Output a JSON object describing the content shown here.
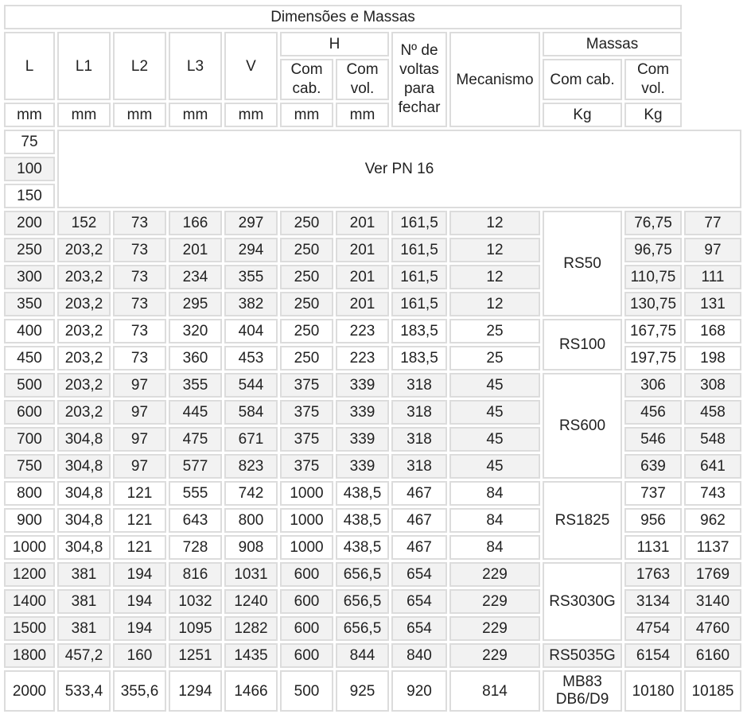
{
  "title": "Dimensões e Massas",
  "headers": {
    "L": "L",
    "L1": "L1",
    "L2": "L2",
    "L3": "L3",
    "V": "V",
    "H": "H",
    "H_cab": "Com cab.",
    "H_vol": "Com vol.",
    "voltas": "Nº de voltas para fechar",
    "mecanismo": "Mecanismo",
    "massas": "Massas",
    "m_cab": "Com cab.",
    "m_vol": "Com vol."
  },
  "units": {
    "L": "mm",
    "L1": "mm",
    "L2": "mm",
    "L3": "mm",
    "V": "mm",
    "H_cab": "mm",
    "H_vol": "mm",
    "m_cab": "Kg",
    "m_vol": "Kg"
  },
  "pn16": {
    "sizes": [
      "75",
      "100",
      "150"
    ],
    "note": "Ver PN 16"
  },
  "rows": [
    {
      "L": "200",
      "L1": "152",
      "L2": "73",
      "L3": "166",
      "V": "297",
      "hc": "250",
      "hv": "201",
      "nv": "161,5",
      "me": "12",
      "mc": "76,75",
      "mv": "77"
    },
    {
      "L": "250",
      "L1": "203,2",
      "L2": "73",
      "L3": "201",
      "V": "294",
      "hc": "250",
      "hv": "201",
      "nv": "161,5",
      "me": "12",
      "mc": "96,75",
      "mv": "97"
    },
    {
      "L": "300",
      "L1": "203,2",
      "L2": "73",
      "L3": "234",
      "V": "355",
      "hc": "250",
      "hv": "201",
      "nv": "161,5",
      "me": "12",
      "mc": "110,75",
      "mv": "111"
    },
    {
      "L": "350",
      "L1": "203,2",
      "L2": "73",
      "L3": "295",
      "V": "382",
      "hc": "250",
      "hv": "201",
      "nv": "161,5",
      "me": "12",
      "mc": "130,75",
      "mv": "131"
    },
    {
      "L": "400",
      "L1": "203,2",
      "L2": "73",
      "L3": "320",
      "V": "404",
      "hc": "250",
      "hv": "223",
      "nv": "183,5",
      "me": "25",
      "mc": "167,75",
      "mv": "168"
    },
    {
      "L": "450",
      "L1": "203,2",
      "L2": "73",
      "L3": "360",
      "V": "453",
      "hc": "250",
      "hv": "223",
      "nv": "183,5",
      "me": "25",
      "mc": "197,75",
      "mv": "198"
    },
    {
      "L": "500",
      "L1": "203,2",
      "L2": "97",
      "L3": "355",
      "V": "544",
      "hc": "375",
      "hv": "339",
      "nv": "318",
      "me": "45",
      "mc": "306",
      "mv": "308"
    },
    {
      "L": "600",
      "L1": "203,2",
      "L2": "97",
      "L3": "445",
      "V": "584",
      "hc": "375",
      "hv": "339",
      "nv": "318",
      "me": "45",
      "mc": "456",
      "mv": "458"
    },
    {
      "L": "700",
      "L1": "304,8",
      "L2": "97",
      "L3": "475",
      "V": "671",
      "hc": "375",
      "hv": "339",
      "nv": "318",
      "me": "45",
      "mc": "546",
      "mv": "548"
    },
    {
      "L": "750",
      "L1": "304,8",
      "L2": "97",
      "L3": "577",
      "V": "823",
      "hc": "375",
      "hv": "339",
      "nv": "318",
      "me": "45",
      "mc": "639",
      "mv": "641"
    },
    {
      "L": "800",
      "L1": "304,8",
      "L2": "121",
      "L3": "555",
      "V": "742",
      "hc": "1000",
      "hv": "438,5",
      "nv": "467",
      "me": "84",
      "mc": "737",
      "mv": "743"
    },
    {
      "L": "900",
      "L1": "304,8",
      "L2": "121",
      "L3": "643",
      "V": "800",
      "hc": "1000",
      "hv": "438,5",
      "nv": "467",
      "me": "84",
      "mc": "956",
      "mv": "962"
    },
    {
      "L": "1000",
      "L1": "304,8",
      "L2": "121",
      "L3": "728",
      "V": "908",
      "hc": "1000",
      "hv": "438,5",
      "nv": "467",
      "me": "84",
      "mc": "1131",
      "mv": "1137"
    },
    {
      "L": "1200",
      "L1": "381",
      "L2": "194",
      "L3": "816",
      "V": "1031",
      "hc": "600",
      "hv": "656,5",
      "nv": "654",
      "me": "229",
      "mc": "1763",
      "mv": "1769"
    },
    {
      "L": "1400",
      "L1": "381",
      "L2": "194",
      "L3": "1032",
      "V": "1240",
      "hc": "600",
      "hv": "656,5",
      "nv": "654",
      "me": "229",
      "mc": "3134",
      "mv": "3140"
    },
    {
      "L": "1500",
      "L1": "381",
      "L2": "194",
      "L3": "1095",
      "V": "1282",
      "hc": "600",
      "hv": "656,5",
      "nv": "654",
      "me": "229",
      "mc": "4754",
      "mv": "4760"
    },
    {
      "L": "1800",
      "L1": "457,2",
      "L2": "160",
      "L3": "1251",
      "V": "1435",
      "hc": "600",
      "hv": "844",
      "nv": "840",
      "me": "229",
      "mc": "6154",
      "mv": "6160"
    },
    {
      "L": "2000",
      "L1": "533,4",
      "L2": "355,6",
      "L3": "1294",
      "V": "1466",
      "hc": "500",
      "hv": "925",
      "nv": "920",
      "me": "814",
      "mc": "10180",
      "mv": "10185"
    }
  ],
  "mechanism_groups": [
    {
      "label": "RS50",
      "start": 0,
      "span": 4
    },
    {
      "label": "RS100",
      "start": 4,
      "span": 2
    },
    {
      "label": "RS600",
      "start": 6,
      "span": 4
    },
    {
      "label": "RS1825",
      "start": 10,
      "span": 3
    },
    {
      "label": "RS3030G",
      "start": 13,
      "span": 3
    },
    {
      "label": "RS5035G",
      "start": 16,
      "span": 1
    },
    {
      "label": "MB83 DB6/D9",
      "start": 17,
      "span": 1
    }
  ],
  "shaded_groups": [
    0,
    2,
    4
  ]
}
